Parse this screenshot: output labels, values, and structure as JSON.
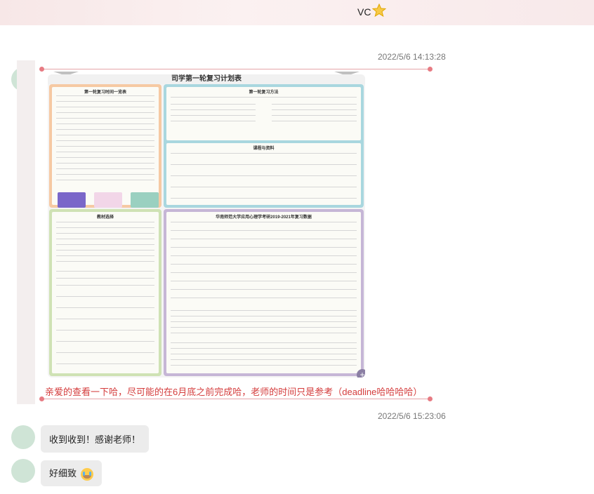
{
  "window": {
    "title": "VC"
  },
  "messages": [
    {
      "timestamp": "2022/5/6 14:13:28",
      "poster": {
        "title": "司学第一轮复习计划表",
        "calendar_title": "第一轮复习时间一览表",
        "methods_title": "第一轮复习方法",
        "resources_title": "课程与资料",
        "books_title": "教材选择",
        "stats_title": "华南师范大学应用心理学考研2019-2021年复习数据"
      },
      "caption": "亲爱的查看一下哈，尽可能的在6月底之前完成哈，老师的时间只是参考（deadline哈哈哈哈）"
    },
    {
      "timestamp": "2022/5/6 15:23:06",
      "text": "收到收到！感谢老师！"
    },
    {
      "text": "好细致"
    }
  ],
  "colors": {
    "caption": "#d43c3c",
    "accent": "#e77b83"
  }
}
